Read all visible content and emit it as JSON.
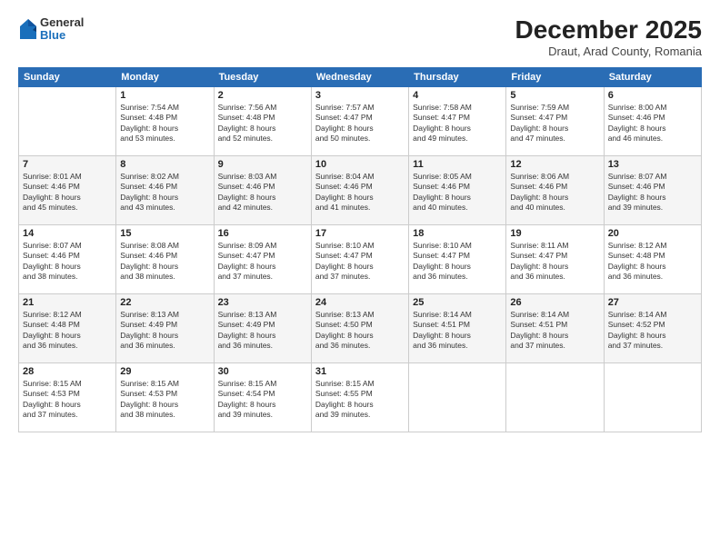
{
  "header": {
    "logo_general": "General",
    "logo_blue": "Blue",
    "month_title": "December 2025",
    "subtitle": "Draut, Arad County, Romania"
  },
  "weekdays": [
    "Sunday",
    "Monday",
    "Tuesday",
    "Wednesday",
    "Thursday",
    "Friday",
    "Saturday"
  ],
  "weeks": [
    [
      {
        "day": "",
        "info": ""
      },
      {
        "day": "1",
        "info": "Sunrise: 7:54 AM\nSunset: 4:48 PM\nDaylight: 8 hours\nand 53 minutes."
      },
      {
        "day": "2",
        "info": "Sunrise: 7:56 AM\nSunset: 4:48 PM\nDaylight: 8 hours\nand 52 minutes."
      },
      {
        "day": "3",
        "info": "Sunrise: 7:57 AM\nSunset: 4:47 PM\nDaylight: 8 hours\nand 50 minutes."
      },
      {
        "day": "4",
        "info": "Sunrise: 7:58 AM\nSunset: 4:47 PM\nDaylight: 8 hours\nand 49 minutes."
      },
      {
        "day": "5",
        "info": "Sunrise: 7:59 AM\nSunset: 4:47 PM\nDaylight: 8 hours\nand 47 minutes."
      },
      {
        "day": "6",
        "info": "Sunrise: 8:00 AM\nSunset: 4:46 PM\nDaylight: 8 hours\nand 46 minutes."
      }
    ],
    [
      {
        "day": "7",
        "info": "Sunrise: 8:01 AM\nSunset: 4:46 PM\nDaylight: 8 hours\nand 45 minutes."
      },
      {
        "day": "8",
        "info": "Sunrise: 8:02 AM\nSunset: 4:46 PM\nDaylight: 8 hours\nand 43 minutes."
      },
      {
        "day": "9",
        "info": "Sunrise: 8:03 AM\nSunset: 4:46 PM\nDaylight: 8 hours\nand 42 minutes."
      },
      {
        "day": "10",
        "info": "Sunrise: 8:04 AM\nSunset: 4:46 PM\nDaylight: 8 hours\nand 41 minutes."
      },
      {
        "day": "11",
        "info": "Sunrise: 8:05 AM\nSunset: 4:46 PM\nDaylight: 8 hours\nand 40 minutes."
      },
      {
        "day": "12",
        "info": "Sunrise: 8:06 AM\nSunset: 4:46 PM\nDaylight: 8 hours\nand 40 minutes."
      },
      {
        "day": "13",
        "info": "Sunrise: 8:07 AM\nSunset: 4:46 PM\nDaylight: 8 hours\nand 39 minutes."
      }
    ],
    [
      {
        "day": "14",
        "info": "Sunrise: 8:07 AM\nSunset: 4:46 PM\nDaylight: 8 hours\nand 38 minutes."
      },
      {
        "day": "15",
        "info": "Sunrise: 8:08 AM\nSunset: 4:46 PM\nDaylight: 8 hours\nand 38 minutes."
      },
      {
        "day": "16",
        "info": "Sunrise: 8:09 AM\nSunset: 4:47 PM\nDaylight: 8 hours\nand 37 minutes."
      },
      {
        "day": "17",
        "info": "Sunrise: 8:10 AM\nSunset: 4:47 PM\nDaylight: 8 hours\nand 37 minutes."
      },
      {
        "day": "18",
        "info": "Sunrise: 8:10 AM\nSunset: 4:47 PM\nDaylight: 8 hours\nand 36 minutes."
      },
      {
        "day": "19",
        "info": "Sunrise: 8:11 AM\nSunset: 4:47 PM\nDaylight: 8 hours\nand 36 minutes."
      },
      {
        "day": "20",
        "info": "Sunrise: 8:12 AM\nSunset: 4:48 PM\nDaylight: 8 hours\nand 36 minutes."
      }
    ],
    [
      {
        "day": "21",
        "info": "Sunrise: 8:12 AM\nSunset: 4:48 PM\nDaylight: 8 hours\nand 36 minutes."
      },
      {
        "day": "22",
        "info": "Sunrise: 8:13 AM\nSunset: 4:49 PM\nDaylight: 8 hours\nand 36 minutes."
      },
      {
        "day": "23",
        "info": "Sunrise: 8:13 AM\nSunset: 4:49 PM\nDaylight: 8 hours\nand 36 minutes."
      },
      {
        "day": "24",
        "info": "Sunrise: 8:13 AM\nSunset: 4:50 PM\nDaylight: 8 hours\nand 36 minutes."
      },
      {
        "day": "25",
        "info": "Sunrise: 8:14 AM\nSunset: 4:51 PM\nDaylight: 8 hours\nand 36 minutes."
      },
      {
        "day": "26",
        "info": "Sunrise: 8:14 AM\nSunset: 4:51 PM\nDaylight: 8 hours\nand 37 minutes."
      },
      {
        "day": "27",
        "info": "Sunrise: 8:14 AM\nSunset: 4:52 PM\nDaylight: 8 hours\nand 37 minutes."
      }
    ],
    [
      {
        "day": "28",
        "info": "Sunrise: 8:15 AM\nSunset: 4:53 PM\nDaylight: 8 hours\nand 37 minutes."
      },
      {
        "day": "29",
        "info": "Sunrise: 8:15 AM\nSunset: 4:53 PM\nDaylight: 8 hours\nand 38 minutes."
      },
      {
        "day": "30",
        "info": "Sunrise: 8:15 AM\nSunset: 4:54 PM\nDaylight: 8 hours\nand 39 minutes."
      },
      {
        "day": "31",
        "info": "Sunrise: 8:15 AM\nSunset: 4:55 PM\nDaylight: 8 hours\nand 39 minutes."
      },
      {
        "day": "",
        "info": ""
      },
      {
        "day": "",
        "info": ""
      },
      {
        "day": "",
        "info": ""
      }
    ]
  ]
}
